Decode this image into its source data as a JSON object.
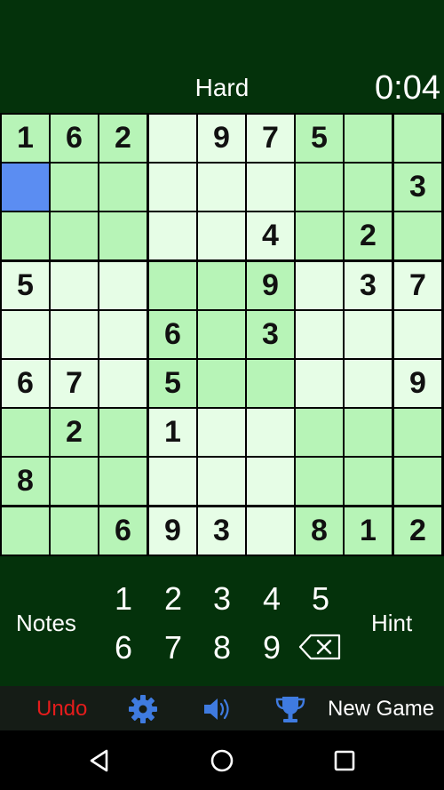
{
  "header": {
    "difficulty": "Hard",
    "timer": "0:04"
  },
  "board": {
    "rows": [
      [
        "1",
        "6",
        "2",
        "",
        "9",
        "7",
        "5",
        "",
        ""
      ],
      [
        "",
        "",
        "",
        "",
        "",
        "",
        "",
        "",
        "3"
      ],
      [
        "",
        "",
        "",
        "",
        "",
        "4",
        "",
        "2",
        ""
      ],
      [
        "5",
        "",
        "",
        "",
        "",
        "9",
        "",
        "3",
        "7"
      ],
      [
        "",
        "",
        "",
        "6",
        "",
        "3",
        "",
        "",
        ""
      ],
      [
        "6",
        "7",
        "",
        "5",
        "",
        "",
        "",
        "",
        "9"
      ],
      [
        "",
        "2",
        "",
        "1",
        "",
        "",
        "",
        "",
        ""
      ],
      [
        "8",
        "",
        "",
        "",
        "",
        "",
        "",
        "",
        ""
      ],
      [
        "",
        "",
        "6",
        "9",
        "3",
        "",
        "8",
        "1",
        "2"
      ]
    ],
    "selected": [
      1,
      0
    ],
    "colors": {
      "light": "#e6fde6",
      "dark": "#b7f4b7",
      "selected": "#5b8df2"
    }
  },
  "controls": {
    "notes_label": "Notes",
    "hint_label": "Hint",
    "numbers_row1": [
      "1",
      "2",
      "3",
      "4",
      "5"
    ],
    "numbers_row2": [
      "6",
      "7",
      "8",
      "9"
    ],
    "erase_icon": "backspace-icon"
  },
  "toolbar": {
    "undo_label": "Undo",
    "undo_color": "#e51c1c",
    "settings_icon": "gear-icon",
    "sound_icon": "speaker-icon",
    "trophy_icon": "trophy-icon",
    "new_game_label": "New Game",
    "icon_color": "#3f7be0"
  },
  "navbar": {
    "icons": [
      "back-triangle-icon",
      "home-circle-icon",
      "recents-square-icon"
    ]
  }
}
